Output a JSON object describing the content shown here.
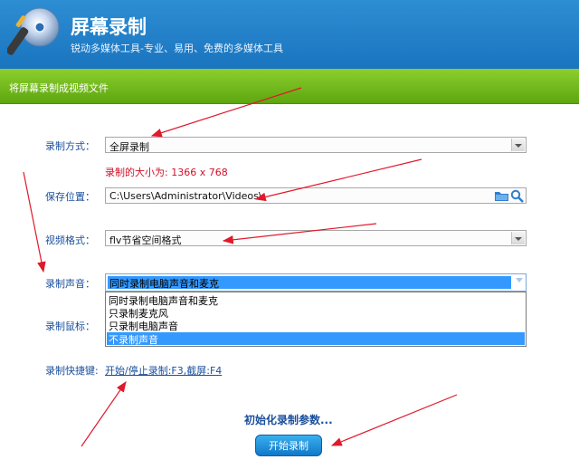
{
  "header": {
    "title": "屏幕录制",
    "subtitle": "锐动多媒体工具-专业、易用、免费的多媒体工具",
    "logo_icon": "disc-brush-icon"
  },
  "section_bar": {
    "text": "将屏幕录制成视频文件"
  },
  "form": {
    "mode_label": "录制方式：",
    "mode_value": "全屏录制",
    "size_info": "录制的大小为: 1366 x 768",
    "save_label": "保存位置：",
    "save_value": "C:\\Users\\Administrator\\Videos\\",
    "format_label": "视频格式：",
    "format_value": "flv节省空间格式",
    "audio_label": "录制声音：",
    "audio_value": "同时录制电脑声音和麦克",
    "audio_options": [
      "同时录制电脑声音和麦克",
      "只录制麦克风",
      "只录制电脑声音",
      "不录制声音"
    ],
    "audio_highlighted_option": "不录制声音",
    "mouse_label": "录制鼠标：",
    "hotkey_label": "录制快捷键:",
    "hotkey_value": "开始/停止录制:F3,截屏:F4"
  },
  "status": {
    "init_text": "初始化录制参数..."
  },
  "buttons": {
    "start_label": "开始录制"
  },
  "colors": {
    "header_blue": "#1a74bf",
    "bar_green": "#6db61a",
    "annotation_red": "#e0192b"
  }
}
